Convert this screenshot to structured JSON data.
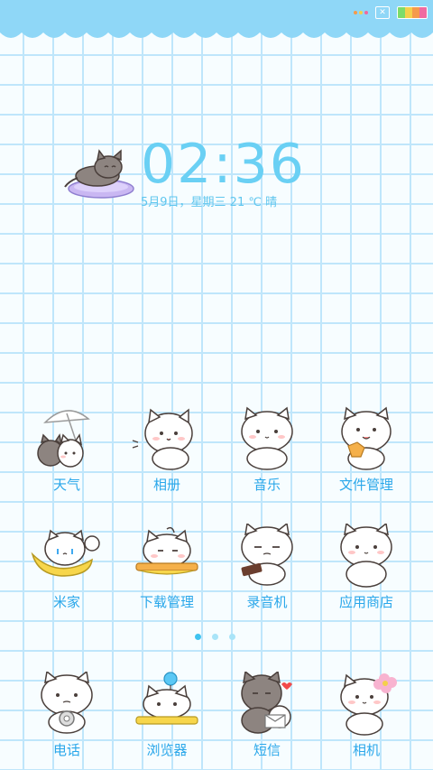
{
  "status_bar": {
    "background": "#8fd7f7",
    "close_icon": "close-box-icon",
    "battery_colors": [
      "#7cdc6a",
      "#f4d04b",
      "#f59a4b",
      "#f06aa0"
    ]
  },
  "clock": {
    "time": "02:36",
    "date_line": "5月9日，星期三    21 ℃    晴",
    "color": "#6ad0f4"
  },
  "apps": [
    {
      "label": "天气",
      "icon": "cat-umbrella-icon"
    },
    {
      "label": "相册",
      "icon": "cat-waving-icon"
    },
    {
      "label": "音乐",
      "icon": "cat-sitting-icon"
    },
    {
      "label": "文件管理",
      "icon": "cat-cookie-icon"
    },
    {
      "label": "米家",
      "icon": "cat-banana-icon"
    },
    {
      "label": "下载管理",
      "icon": "cat-bowl-icon"
    },
    {
      "label": "录音机",
      "icon": "cat-smug-icon"
    },
    {
      "label": "应用商店",
      "icon": "cat-shy-icon"
    }
  ],
  "dock": [
    {
      "label": "电话",
      "icon": "cat-phone-icon"
    },
    {
      "label": "浏览器",
      "icon": "cat-balloon-icon"
    },
    {
      "label": "短信",
      "icon": "cat-letter-icon"
    },
    {
      "label": "相机",
      "icon": "cat-flower-icon"
    }
  ],
  "page_indicator": {
    "count": 3,
    "active_index": 0,
    "active_color": "#3fc3f0",
    "inactive_color": "#a9e4f8"
  }
}
